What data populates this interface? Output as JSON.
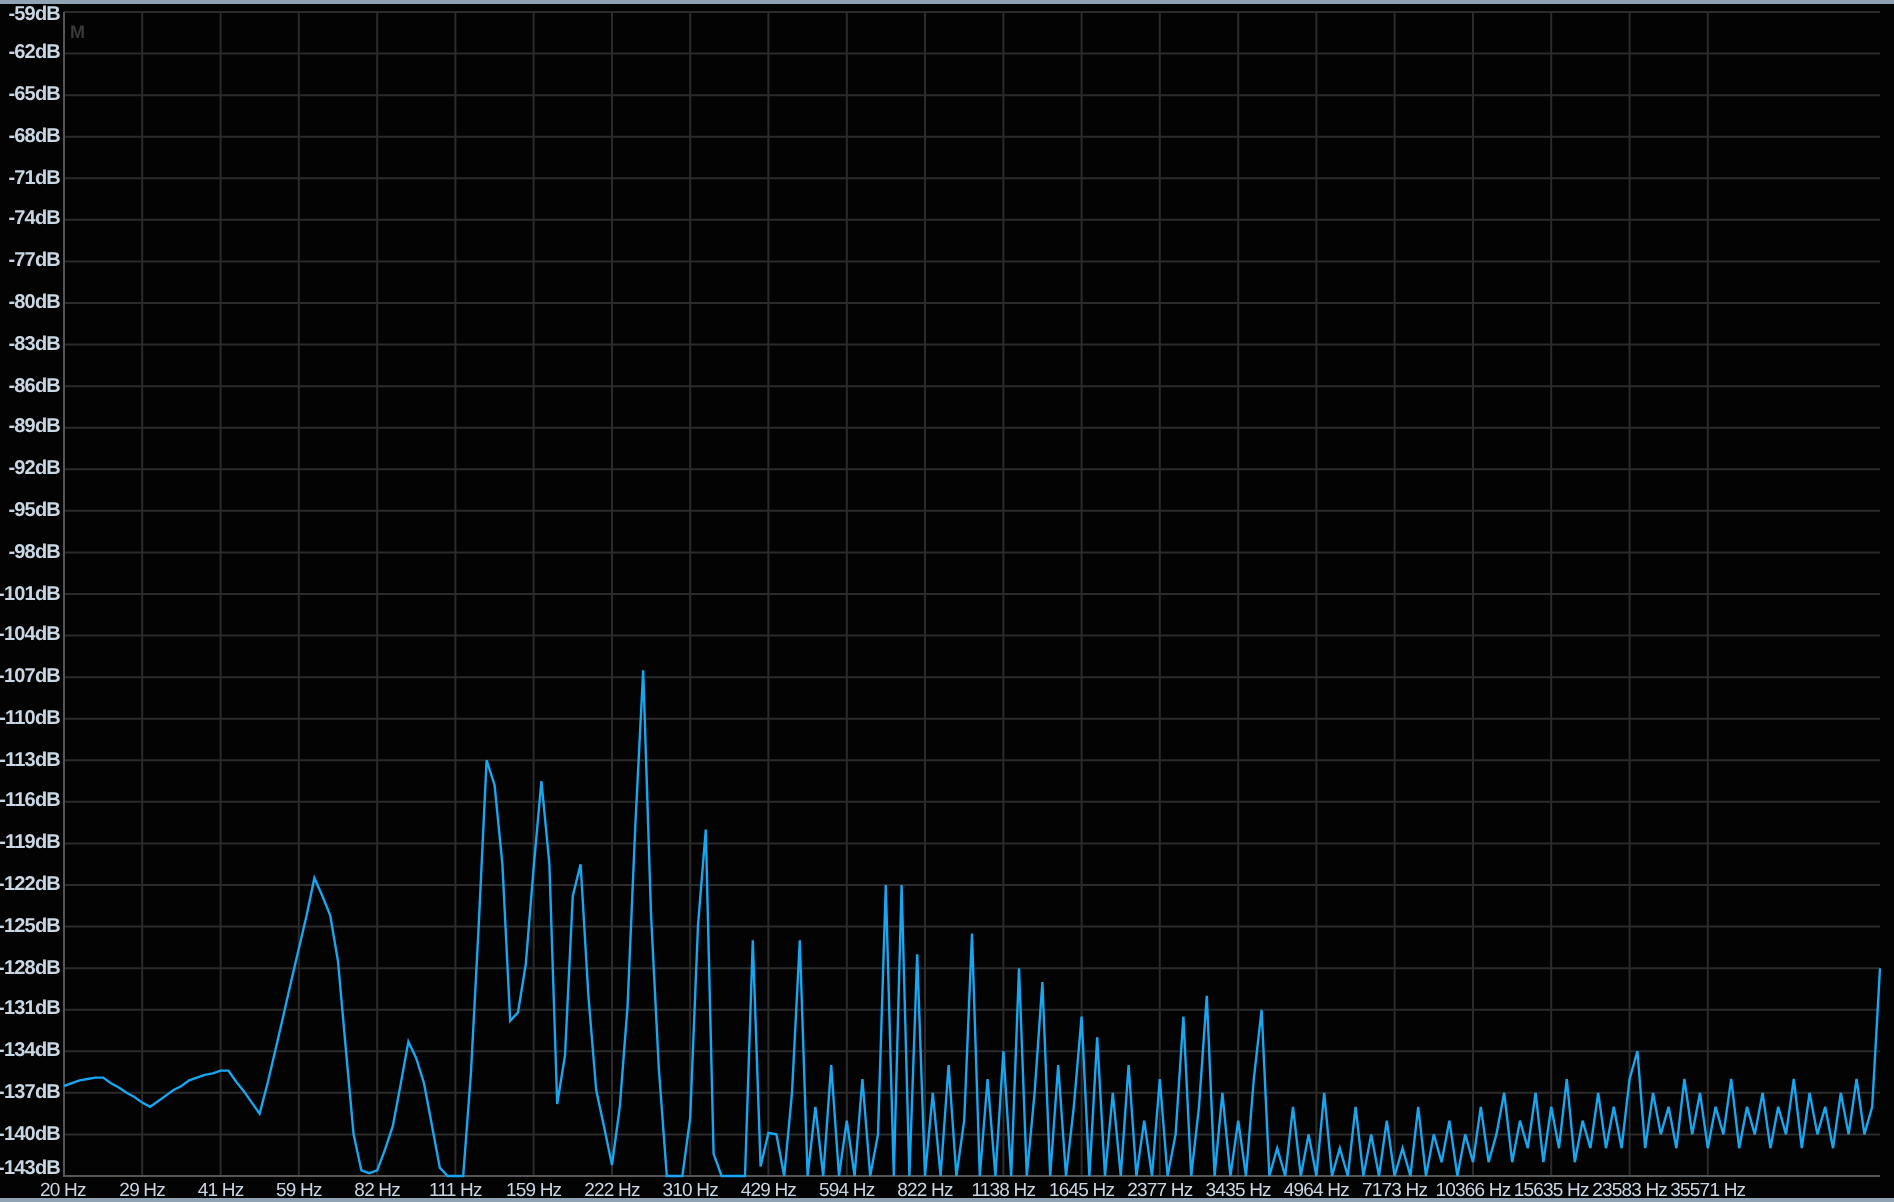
{
  "marker_label": "M",
  "chart_data": {
    "type": "line",
    "grid": true,
    "ylim": [
      -143,
      -59
    ],
    "yticks": [
      {
        "value": -59,
        "label": "-59dB"
      },
      {
        "value": -62,
        "label": "-62dB"
      },
      {
        "value": -65,
        "label": "-65dB"
      },
      {
        "value": -68,
        "label": "-68dB"
      },
      {
        "value": -71,
        "label": "-71dB"
      },
      {
        "value": -74,
        "label": "-74dB"
      },
      {
        "value": -77,
        "label": "-77dB"
      },
      {
        "value": -80,
        "label": "-80dB"
      },
      {
        "value": -83,
        "label": "-83dB"
      },
      {
        "value": -86,
        "label": "-86dB"
      },
      {
        "value": -89,
        "label": "-89dB"
      },
      {
        "value": -92,
        "label": "-92dB"
      },
      {
        "value": -95,
        "label": "-95dB"
      },
      {
        "value": -98,
        "label": "-98dB"
      },
      {
        "value": -101,
        "label": "-101dB"
      },
      {
        "value": -104,
        "label": "-104dB"
      },
      {
        "value": -107,
        "label": "-107dB"
      },
      {
        "value": -110,
        "label": "-110dB"
      },
      {
        "value": -113,
        "label": "-113dB"
      },
      {
        "value": -116,
        "label": "-116dB"
      },
      {
        "value": -119,
        "label": "-119dB"
      },
      {
        "value": -122,
        "label": "-122dB"
      },
      {
        "value": -125,
        "label": "-125dB"
      },
      {
        "value": -128,
        "label": "-128dB"
      },
      {
        "value": -131,
        "label": "-131dB"
      },
      {
        "value": -134,
        "label": "-134dB"
      },
      {
        "value": -137,
        "label": "-137dB"
      },
      {
        "value": -140,
        "label": "-140dB"
      },
      {
        "value": -143,
        "label": "-143dB"
      }
    ],
    "categories": [
      "20 Hz",
      null,
      null,
      null,
      null,
      null,
      null,
      null,
      null,
      null,
      "29 Hz",
      null,
      null,
      null,
      null,
      null,
      null,
      null,
      null,
      null,
      "41 Hz",
      null,
      null,
      null,
      null,
      null,
      null,
      null,
      null,
      null,
      "59 Hz",
      null,
      null,
      null,
      null,
      null,
      null,
      null,
      null,
      null,
      "82 Hz",
      null,
      null,
      null,
      null,
      null,
      null,
      null,
      null,
      null,
      "111 Hz",
      null,
      null,
      null,
      null,
      null,
      null,
      null,
      null,
      null,
      "159 Hz",
      null,
      null,
      null,
      null,
      null,
      null,
      null,
      null,
      null,
      "222 Hz",
      null,
      null,
      null,
      null,
      null,
      null,
      null,
      null,
      null,
      "310 Hz",
      null,
      null,
      null,
      null,
      null,
      null,
      null,
      null,
      null,
      "429 Hz",
      null,
      null,
      null,
      null,
      null,
      null,
      null,
      null,
      null,
      "594 Hz",
      null,
      null,
      null,
      null,
      null,
      null,
      null,
      null,
      null,
      "822 Hz",
      null,
      null,
      null,
      null,
      null,
      null,
      null,
      null,
      null,
      "1138 Hz",
      null,
      null,
      null,
      null,
      null,
      null,
      null,
      null,
      null,
      "1645 Hz",
      null,
      null,
      null,
      null,
      null,
      null,
      null,
      null,
      null,
      "2377 Hz",
      null,
      null,
      null,
      null,
      null,
      null,
      null,
      null,
      null,
      "3435 Hz",
      null,
      null,
      null,
      null,
      null,
      null,
      null,
      null,
      null,
      "4964 Hz",
      null,
      null,
      null,
      null,
      null,
      null,
      null,
      null,
      null,
      "7173 Hz",
      null,
      null,
      null,
      null,
      null,
      null,
      null,
      null,
      null,
      "10366 Hz",
      null,
      null,
      null,
      null,
      null,
      null,
      null,
      null,
      null,
      "15635 Hz",
      null,
      null,
      null,
      null,
      null,
      null,
      null,
      null,
      null,
      "23583 Hz",
      null,
      null,
      null,
      null,
      null,
      null,
      null,
      null,
      null,
      "35571 Hz",
      null,
      null,
      null,
      null,
      null,
      null,
      null,
      null,
      null,
      null,
      null,
      null,
      null,
      null,
      null,
      null,
      null,
      null,
      null,
      null,
      null,
      null
    ],
    "series": [
      {
        "color": "#18a6f0",
        "values": [
          -136.5,
          -136.3,
          -136.1,
          -136.0,
          -135.9,
          -135.9,
          -136.3,
          -136.6,
          -137.0,
          -137.3,
          -137.7,
          -138,
          -137.6,
          -137.2,
          -136.8,
          -136.5,
          -136.1,
          -135.9,
          -135.7,
          -135.6,
          -135.4,
          -135.4,
          -136.2,
          -136.9,
          -137.7,
          -138.5,
          -136.3,
          -133.9,
          -131.5,
          -129,
          -126.6,
          -124.2,
          -121.5,
          -122.8,
          -124.2,
          -127.5,
          -133.8,
          -140,
          -142.6,
          -142.8,
          -142.6,
          -141.1,
          -139.4,
          -136.4,
          -133.3,
          -134.5,
          -136.3,
          -139.3,
          -142.4,
          -143,
          -143,
          -143,
          -135.5,
          -124.8,
          -113,
          -114.8,
          -120.5,
          -131.8,
          -131.2,
          -127.7,
          -120.8,
          -114.5,
          -120.5,
          -137.8,
          -134.3,
          -122.8,
          -120.5,
          -130,
          -136.8,
          -139.5,
          -142.2,
          -138,
          -130.7,
          -117.6,
          -106.5,
          -124.1,
          -135.2,
          -143,
          -143,
          -143,
          -138.8,
          -124.9,
          -118,
          -141.4,
          -143,
          -143,
          -143,
          -143,
          -126,
          -142.3,
          -139.9,
          -140,
          -143,
          -137,
          -126,
          -143,
          -138,
          -143,
          -135,
          -143,
          -139,
          -143,
          -136,
          -143,
          -140,
          -122,
          -143,
          -122,
          -143,
          -127,
          -143,
          -137,
          -143,
          -135,
          -143,
          -139,
          -125.5,
          -143,
          -136,
          -143,
          -134,
          -143,
          -128,
          -143,
          -137,
          -129,
          -143,
          -135,
          -143,
          -138,
          -131.5,
          -143,
          -133,
          -143,
          -137,
          -143,
          -135,
          -143,
          -139,
          -143,
          -136,
          -143,
          -140,
          -131.5,
          -143,
          -138,
          -130,
          -143,
          -137,
          -143,
          -139,
          -143,
          -136,
          -131,
          -143,
          -141,
          -143,
          -138,
          -143,
          -140,
          -143,
          -137,
          -143,
          -141,
          -143,
          -138,
          -143,
          -140,
          -143,
          -139,
          -143,
          -141,
          -143,
          -138,
          -143,
          -140,
          -142,
          -139,
          -143,
          -140,
          -142,
          -138,
          -142,
          -140,
          -137,
          -142,
          -139,
          -141,
          -137,
          -142,
          -138,
          -141,
          -136,
          -142,
          -139,
          -141,
          -137,
          -141,
          -138,
          -141,
          -136,
          -134,
          -141,
          -137,
          -140,
          -138,
          -141,
          -136,
          -140,
          -137,
          -141,
          -138,
          -140,
          -136,
          -141,
          -138,
          -140,
          -137,
          -141,
          -138,
          -140,
          -136,
          -141,
          -137,
          -140,
          -138,
          -141,
          -137,
          -140,
          -136,
          -140,
          -138,
          -128
        ]
      }
    ]
  }
}
